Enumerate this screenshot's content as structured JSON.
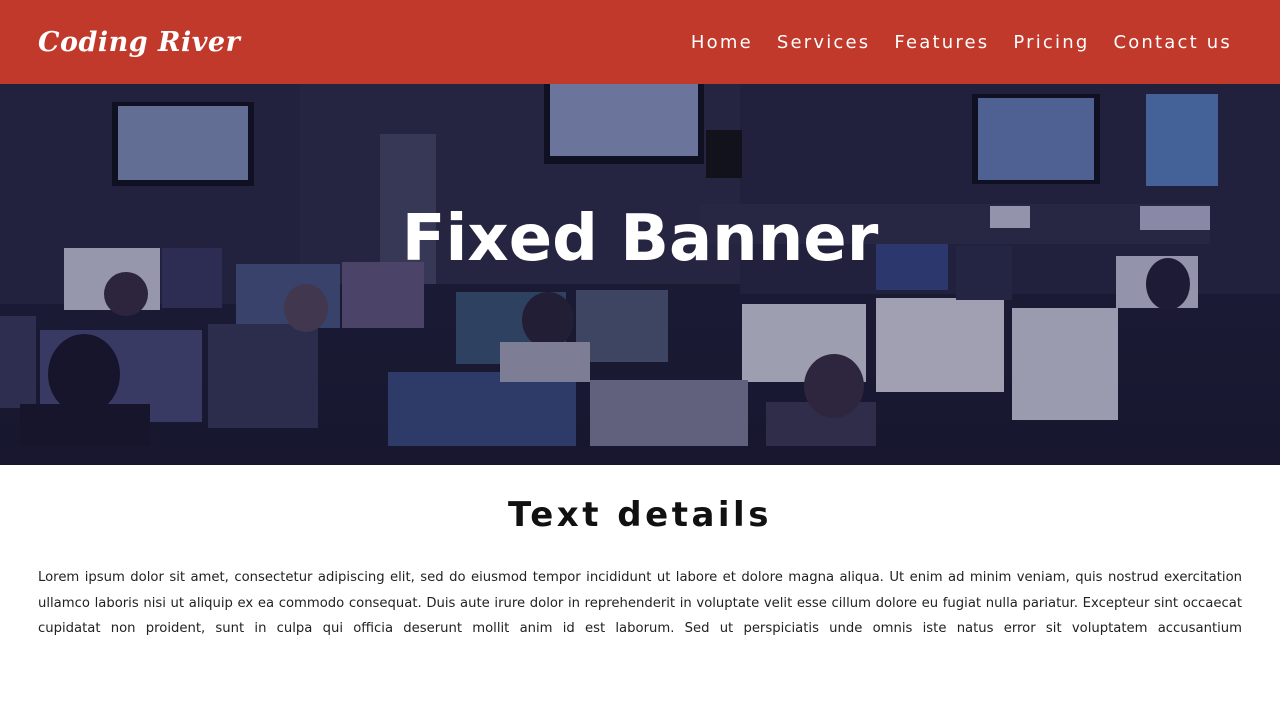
{
  "navbar": {
    "brand": "Coding River",
    "links": [
      "Home",
      "Services",
      "Features",
      "Pricing",
      "Contact us"
    ]
  },
  "banner": {
    "title": "Fixed Banner",
    "image_description_icon": "control-room-photo"
  },
  "content": {
    "heading": "Text details",
    "paragraph": "Lorem ipsum dolor sit amet, consectetur adipiscing elit, sed do eiusmod tempor incididunt ut labore et dolore magna aliqua. Ut enim ad minim veniam, quis nostrud exercitation ullamco laboris nisi ut aliquip ex ea commodo consequat. Duis aute irure dolor in reprehenderit in voluptate velit esse cillum dolore eu fugiat nulla pariatur. Excepteur sint occaecat cupidatat non proident, sunt in culpa qui officia deserunt mollit anim id est laborum. Sed ut perspiciatis unde omnis iste natus error sit voluptatem accusantium"
  },
  "colors": {
    "navbar_bg": "#c0392b",
    "banner_overlay": "#1d1c33",
    "text": "#111111"
  }
}
